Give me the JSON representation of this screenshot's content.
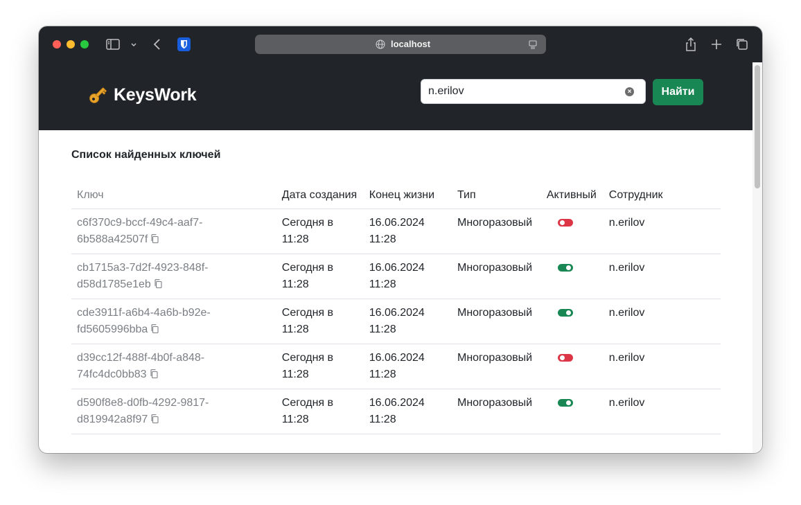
{
  "browser": {
    "url": "localhost"
  },
  "header": {
    "brand": "KeysWork",
    "search_value": "n.erilov",
    "search_button": "Найти"
  },
  "list": {
    "title": "Список найденных ключей",
    "columns": {
      "key": "Ключ",
      "created": "Дата создания",
      "expires": "Конец жизни",
      "type": "Тип",
      "active": "Активный",
      "employee": "Сотрудник"
    },
    "rows": [
      {
        "key": "c6f370c9-bccf-49c4-aaf7-6b588a42507f",
        "created": "Сегодня в 11:28",
        "expires": "16.06.2024 11:28",
        "type": "Многоразовый",
        "active": false,
        "employee": "n.erilov"
      },
      {
        "key": "cb1715a3-7d2f-4923-848f-d58d1785e1eb",
        "created": "Сегодня в 11:28",
        "expires": "16.06.2024 11:28",
        "type": "Многоразовый",
        "active": true,
        "employee": "n.erilov"
      },
      {
        "key": "cde3911f-a6b4-4a6b-b92e-fd5605996bba",
        "created": "Сегодня в 11:28",
        "expires": "16.06.2024 11:28",
        "type": "Многоразовый",
        "active": true,
        "employee": "n.erilov"
      },
      {
        "key": "d39cc12f-488f-4b0f-a848-74fc4dc0bb83",
        "created": "Сегодня в 11:28",
        "expires": "16.06.2024 11:28",
        "type": "Многоразовый",
        "active": false,
        "employee": "n.erilov"
      },
      {
        "key": "d590f8e8-d0fb-4292-9817-d819942a8f97",
        "created": "Сегодня в 11:28",
        "expires": "16.06.2024 11:28",
        "type": "Многоразовый",
        "active": true,
        "employee": "n.erilov"
      }
    ]
  },
  "colors": {
    "header_bg": "#212529",
    "accent_green": "#198754",
    "inactive_red": "#dc3545"
  }
}
